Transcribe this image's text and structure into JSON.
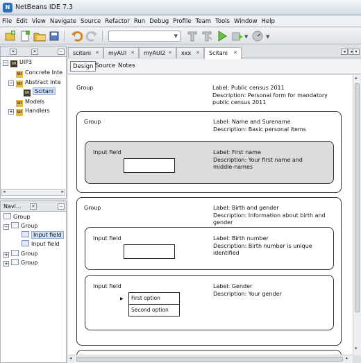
{
  "window": {
    "title": "NetBeans IDE 7.3",
    "app_icon": "netbeans-icon"
  },
  "menu": [
    "File",
    "Edit",
    "View",
    "Navigate",
    "Source",
    "Refactor",
    "Run",
    "Debug",
    "Profile",
    "Team",
    "Tools",
    "Window",
    "Help"
  ],
  "toolbar": {
    "icons": [
      "new-project-icon",
      "new-file-icon",
      "open-project-icon",
      "save-all-icon",
      "undo-icon",
      "redo-icon",
      "config-combo",
      "build-icon",
      "clean-build-icon",
      "run-icon",
      "debug-icon",
      "profile-icon"
    ],
    "config_value": ""
  },
  "projects": {
    "tree": [
      {
        "label": "UIP3",
        "level": 0
      },
      {
        "label": "Concrete Inte",
        "level": 1
      },
      {
        "label": "Abstract Inte",
        "level": 1
      },
      {
        "label": "Scitani",
        "level": 2
      },
      {
        "label": "Models",
        "level": 1
      },
      {
        "label": "Handlers",
        "level": 1
      }
    ]
  },
  "navigator": {
    "title": "Navi...",
    "tree": [
      {
        "label": "Group",
        "level": 0
      },
      {
        "label": "Group",
        "level": 1
      },
      {
        "label": "Input field",
        "level": 2
      },
      {
        "label": "Input field",
        "level": 2
      },
      {
        "label": "Group",
        "level": 1
      },
      {
        "label": "Group",
        "level": 1
      }
    ]
  },
  "editor": {
    "tabs": [
      "scitani",
      "myAUI",
      "myAUI2",
      "xxx",
      "Scitani"
    ],
    "active_tab": "Scitani",
    "views": [
      "Design",
      "Source",
      "Notes"
    ],
    "active_view": "Design"
  },
  "design": {
    "root": {
      "type": "Group",
      "label": "Label: Public census 2011",
      "description": "Description: Personal form for mandatory public census 2011"
    },
    "name_group": {
      "type": "Group",
      "label": "Label: Name and Surename",
      "description": "Description: Basic personal items",
      "field": {
        "type": "Input field",
        "label": "Label: First name",
        "description": "Description: Your first name and middle-names"
      }
    },
    "birth_group": {
      "type": "Group",
      "label": "Label: Birth and gender",
      "description": "Description: Information about birth and gender",
      "birth_field": {
        "type": "Input field",
        "label": "Label: Birth number",
        "description": "Description: Birth number is unique identified"
      },
      "gender_field": {
        "type": "Input field",
        "label": "Label: Gender",
        "description": "Description: Your gender",
        "options": [
          "First option",
          "Second option"
        ]
      }
    }
  }
}
